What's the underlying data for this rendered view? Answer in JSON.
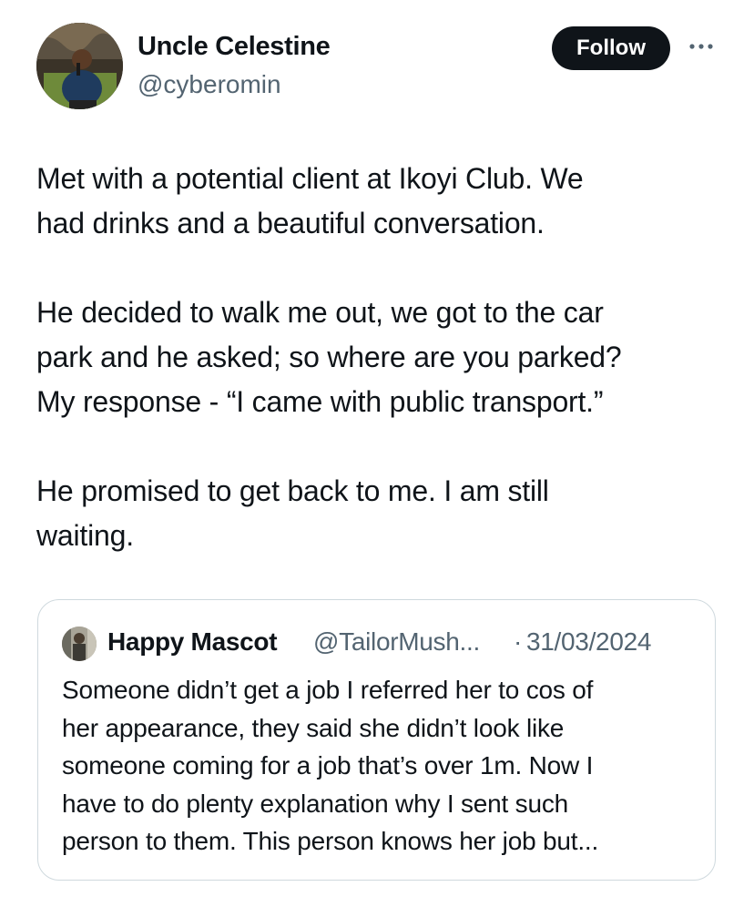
{
  "author": {
    "name": "Uncle Celestine",
    "handle": "@cyberomin",
    "avatar_icon": "profile-photo"
  },
  "actions": {
    "follow_label": "Follow",
    "more_icon": "more-horizontal-icon"
  },
  "tweet": {
    "paragraphs": [
      [
        "Met with a potential client at Ikoyi Club. We",
        "had drinks and a beautiful conversation."
      ],
      [
        "He decided to walk me out, we got to the car",
        "park and he asked; so where are you parked?",
        "My response - “I came with public transport.”"
      ],
      [
        "He promised to get back to me. I am still",
        "waiting."
      ]
    ]
  },
  "quoted_tweet": {
    "author_name": "Happy Mascot",
    "handle": "@TailorMush...",
    "separator": "·",
    "date": "31/03/2024",
    "lines": [
      "Someone didn’t get a job I referred her to cos of",
      "her appearance, they said she didn’t look like",
      "someone coming for a job that’s over 1m. Now I",
      "have to do plenty explanation why I sent such",
      "person to them. This person knows her job but..."
    ]
  },
  "colors": {
    "text": "#0f1419",
    "secondary": "#536471",
    "border": "#cfd9de",
    "button_bg": "#0f1419",
    "button_text": "#ffffff"
  }
}
